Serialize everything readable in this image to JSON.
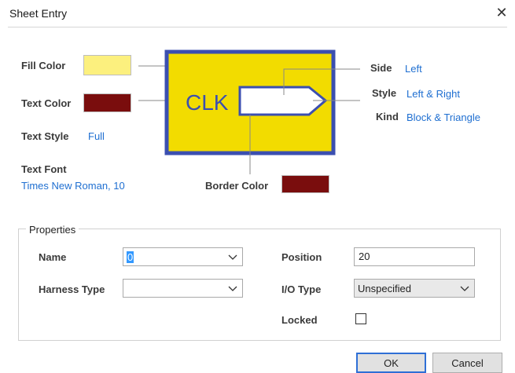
{
  "dialog": {
    "title": "Sheet Entry"
  },
  "preview": {
    "fill_color_label": "Fill Color",
    "fill_color": "#fcf07e",
    "text_color_label": "Text Color",
    "text_color": "#7a0d0d",
    "text_style_label": "Text Style",
    "text_style": "Full",
    "text_font_label": "Text Font",
    "text_font": "Times New Roman, 10",
    "border_color_label": "Border Color",
    "border_color": "#7a0d0d",
    "side_label": "Side",
    "side": "Left",
    "style_label": "Style",
    "style": "Left & Right",
    "kind_label": "Kind",
    "kind": "Block & Triangle",
    "sample_text": "CLK",
    "sample_fill": "#f2dc00",
    "sample_border": "#3b4fb0"
  },
  "properties": {
    "group_title": "Properties",
    "name_label": "Name",
    "name_value": "0",
    "harness_type_label": "Harness Type",
    "harness_type_value": "",
    "position_label": "Position",
    "position_value": "20",
    "io_type_label": "I/O Type",
    "io_type_value": "Unspecified",
    "locked_label": "Locked",
    "locked": false
  },
  "buttons": {
    "ok": "OK",
    "cancel": "Cancel"
  },
  "icons": {
    "close": "close-icon",
    "dropdown": "chevron-down-icon"
  }
}
